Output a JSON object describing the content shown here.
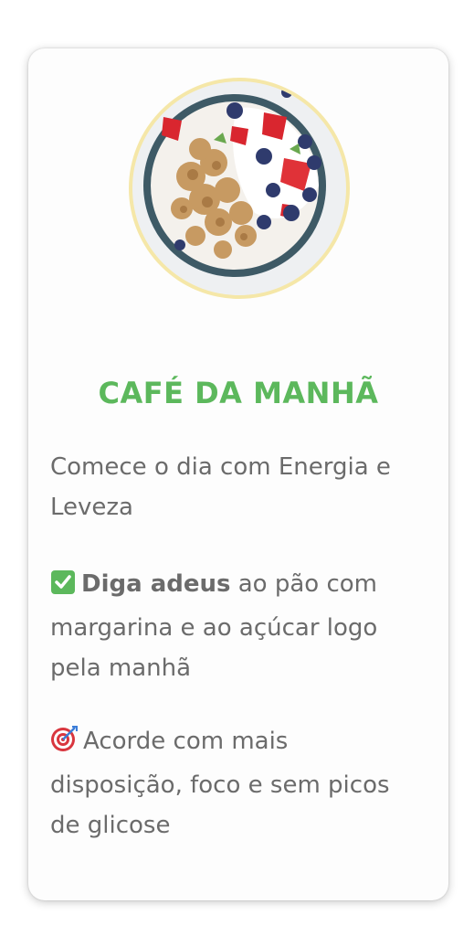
{
  "card": {
    "title": "CAFÉ DA MANHÃ",
    "intro": "Comece o dia com Energia e Leveza",
    "point1": {
      "icon": "check-mark-icon",
      "bold": "Diga adeus",
      "rest": " ao pão com margarina e ao açúcar logo pela manhã"
    },
    "point2": {
      "icon": "target-icon",
      "text": "Acorde com mais disposição, foco e sem picos de glicose"
    }
  },
  "colors": {
    "title": "#5cb85c",
    "body_text": "#6b6b6b",
    "check_bg": "#5cb85c",
    "target": "#d9363e",
    "photo_ring": "#f5e7a8"
  }
}
